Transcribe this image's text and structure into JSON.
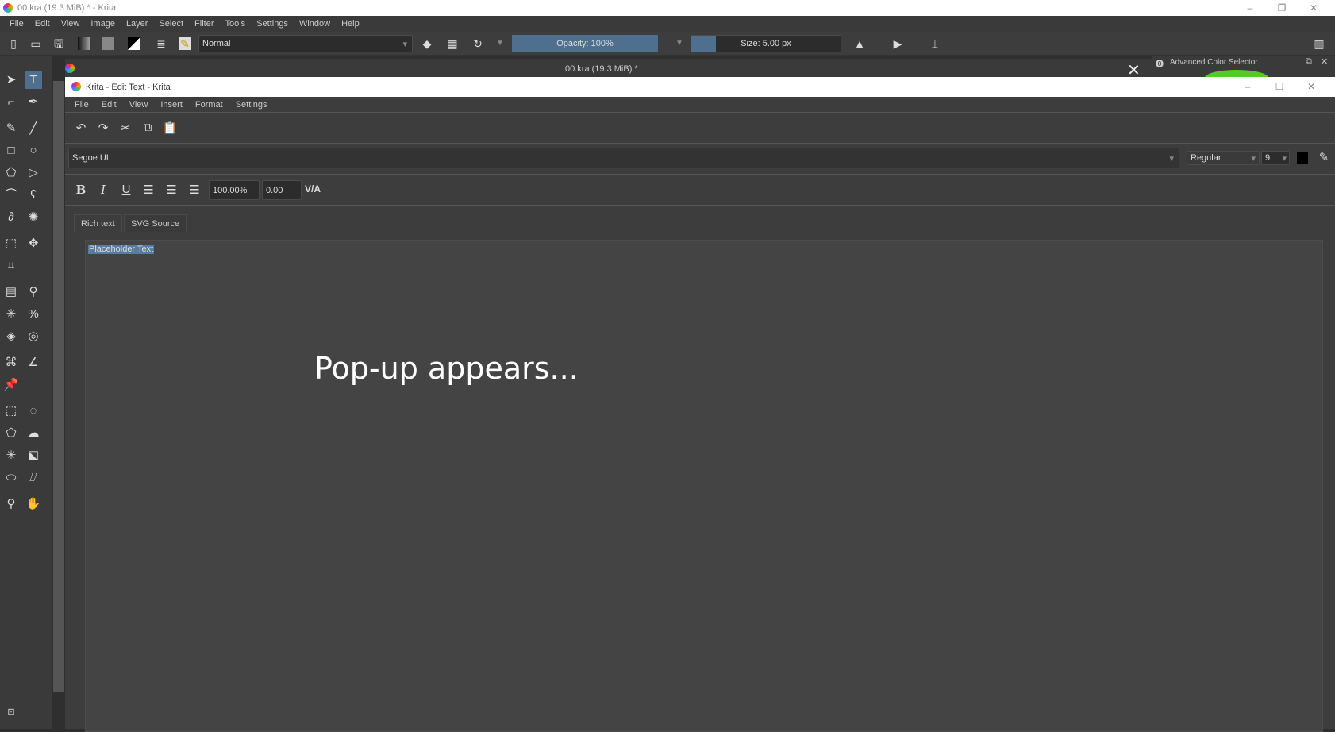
{
  "window": {
    "title": "00.kra (19.3 MiB) * - Krita",
    "controls": [
      "–",
      "❐",
      "✕"
    ]
  },
  "menubar": [
    "File",
    "Edit",
    "View",
    "Image",
    "Layer",
    "Select",
    "Filter",
    "Tools",
    "Settings",
    "Window",
    "Help"
  ],
  "toolbar": {
    "blend_mode": "Normal",
    "opacity": "Opacity: 100%",
    "size": "Size: 5.00 px",
    "opacity_fraction": 1.0
  },
  "document_tab": {
    "title": "00.kra (19.3 MiB) *"
  },
  "docker": {
    "title": "Advanced Color Selector"
  },
  "dialog": {
    "title": "Krita - Edit Text - Krita",
    "controls": [
      "–",
      "☐",
      "✕"
    ],
    "menu": [
      "File",
      "Edit",
      "View",
      "Insert",
      "Format",
      "Settings"
    ],
    "font_family": "Segoe UI",
    "font_style": "Regular",
    "font_size": "9",
    "line_height": "100.00%",
    "letter_spacing": "0.00",
    "tabs": [
      "Rich text",
      "SVG Source"
    ],
    "content": "Placeholder Text"
  },
  "overlay_caption": "Pop-up appears...",
  "colors": {
    "accent": "#4f6f8f",
    "selection": "#5a7ba0"
  }
}
